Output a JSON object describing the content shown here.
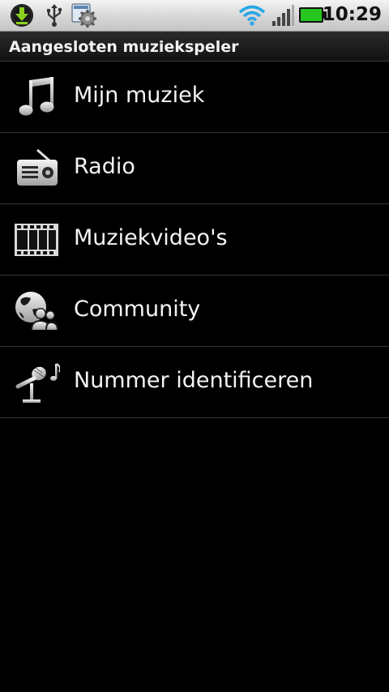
{
  "status_bar": {
    "time": "10:29",
    "icons": [
      "download-icon",
      "usb-icon",
      "settings-icon",
      "wifi-icon",
      "signal-icon",
      "battery-icon"
    ],
    "accent_colors": {
      "download": "#7cc417",
      "wifi": "#2aa6e6",
      "battery": "#22c21f"
    }
  },
  "title_bar": {
    "title": "Aangesloten muziekspeler"
  },
  "menu": {
    "items": [
      {
        "label": "Mijn muziek",
        "icon": "music-note-icon"
      },
      {
        "label": "Radio",
        "icon": "radio-icon"
      },
      {
        "label": "Muziekvideo's",
        "icon": "film-icon"
      },
      {
        "label": "Community",
        "icon": "community-icon"
      },
      {
        "label": "Nummer identificeren",
        "icon": "microphone-note-icon"
      }
    ]
  }
}
